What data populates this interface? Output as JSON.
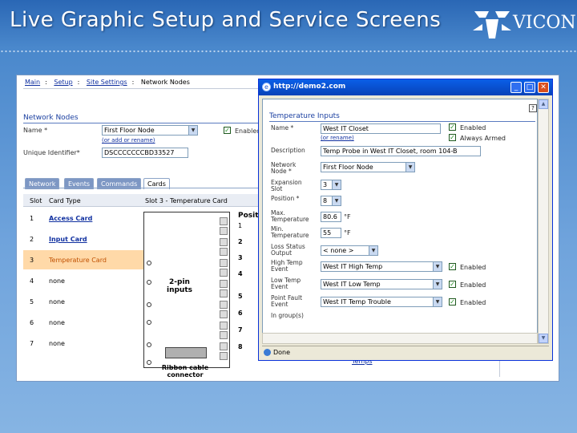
{
  "slide": {
    "title": "Live Graphic Setup and Service Screens",
    "logo_text": "VICON"
  },
  "main": {
    "breadcrumb": [
      "Main",
      "Setup",
      "Site Settings",
      "Network Nodes"
    ],
    "heading": "Network Nodes",
    "name_label": "Name *",
    "name_value": "First Floor Node",
    "name_links": "(or add or rename)",
    "enabled_label": "Enabled",
    "unique_label": "Unique Identifier*",
    "unique_value": "DSCCCCCCCBD33527",
    "tabs": [
      "Network",
      "Events",
      "Commands",
      "Cards"
    ],
    "slot_header": "Slot",
    "card_type_header": "Card Type",
    "slot_detail_header": "Slot 3 - Temperature Card",
    "slots": [
      {
        "num": "1",
        "name": "Access Card",
        "link": true
      },
      {
        "num": "2",
        "name": "Input Card",
        "link": true
      },
      {
        "num": "3",
        "name": "Temperature Card",
        "link": false,
        "highlight": true
      },
      {
        "num": "4",
        "name": "none",
        "link": false
      },
      {
        "num": "5",
        "name": "none",
        "link": false
      },
      {
        "num": "6",
        "name": "none",
        "link": false
      },
      {
        "num": "7",
        "name": "none",
        "link": false
      }
    ],
    "diagram_label": "2-pin inputs",
    "connector_label": "Ribbon cable connector",
    "posi_header": "Positi",
    "posi_numbers": [
      "1",
      "2",
      "3",
      "4",
      "5",
      "6",
      "7",
      "8"
    ],
    "bottom_link": "Temps"
  },
  "popup": {
    "title": "http://demo2.com",
    "heading": "Temperature Inputs",
    "name_label": "Name *",
    "name_value": "West IT Closet",
    "name_link": "(or rename)",
    "enabled_label": "Enabled",
    "always_armed_label": "Always Armed",
    "description_label": "Description",
    "description_value": "Temp Probe in West IT Closet, room 104-B",
    "network_node_label": "Network Node *",
    "network_node_value": "First Floor Node",
    "expansion_slot_label": "Expansion Slot",
    "expansion_slot_value": "3",
    "position_label": "Position *",
    "position_value": "8",
    "max_temp_label": "Max. Temperature",
    "max_temp_value": "80.6",
    "min_temp_label": "Min. Temperature",
    "min_temp_value": "55",
    "unit_f": "°F",
    "loss_status_label": "Loss Status Output",
    "loss_status_value": "< none >",
    "high_temp_label": "High Temp Event",
    "high_temp_value": "West IT High Temp",
    "low_temp_label": "Low Temp Event",
    "low_temp_value": "West IT Low Temp",
    "point_fault_label": "Point Fault Event",
    "point_fault_value": "West IT Temp Trouble",
    "in_groups_label": "In group(s)",
    "event_enabled_label": "Enabled",
    "status_text": "Done"
  }
}
